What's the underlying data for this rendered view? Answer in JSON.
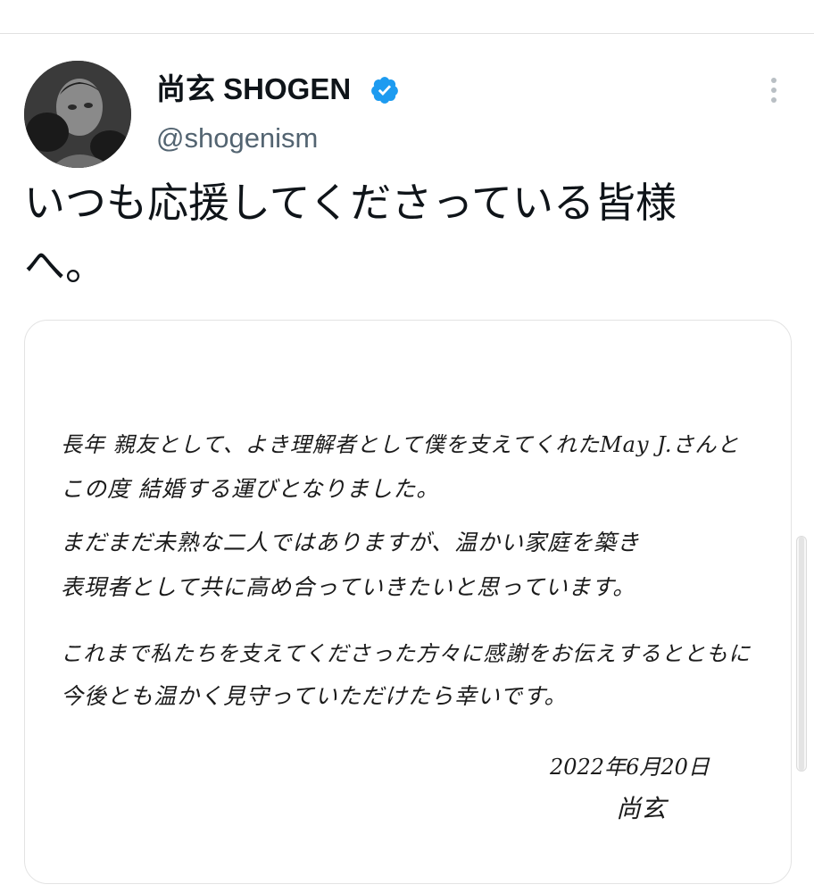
{
  "tweet": {
    "author": {
      "display_name": "尚玄 SHOGEN",
      "handle": "@shogenism",
      "verified": true,
      "avatar_icon": "boxer-photo-avatar"
    },
    "text_lines": [
      "いつも応援してくださっている皆様",
      "へ。"
    ],
    "more_icon": "more-vertical-icon"
  },
  "media": {
    "letter": {
      "paragraph1": [
        "長年 親友として、よき理解者として僕を支えてくれたMay J.さんと",
        "この度 結婚する運びとなりました。"
      ],
      "paragraph2": [
        "まだまだ未熟な二人ではありますが、温かい家庭を築き",
        "表現者として共に高め合っていきたいと思っています。"
      ],
      "paragraph3": [
        "これまで私たちを支えてくださった方々に感謝をお伝えするとともに",
        "今後とも温かく見守っていただけたら幸いです。"
      ],
      "date": "2022年6月20日",
      "signature": "尚玄"
    }
  },
  "colors": {
    "text_primary": "#0f1419",
    "text_secondary": "#536471",
    "verified_blue": "#1d9bf0",
    "card_border": "#e3e3e3"
  }
}
